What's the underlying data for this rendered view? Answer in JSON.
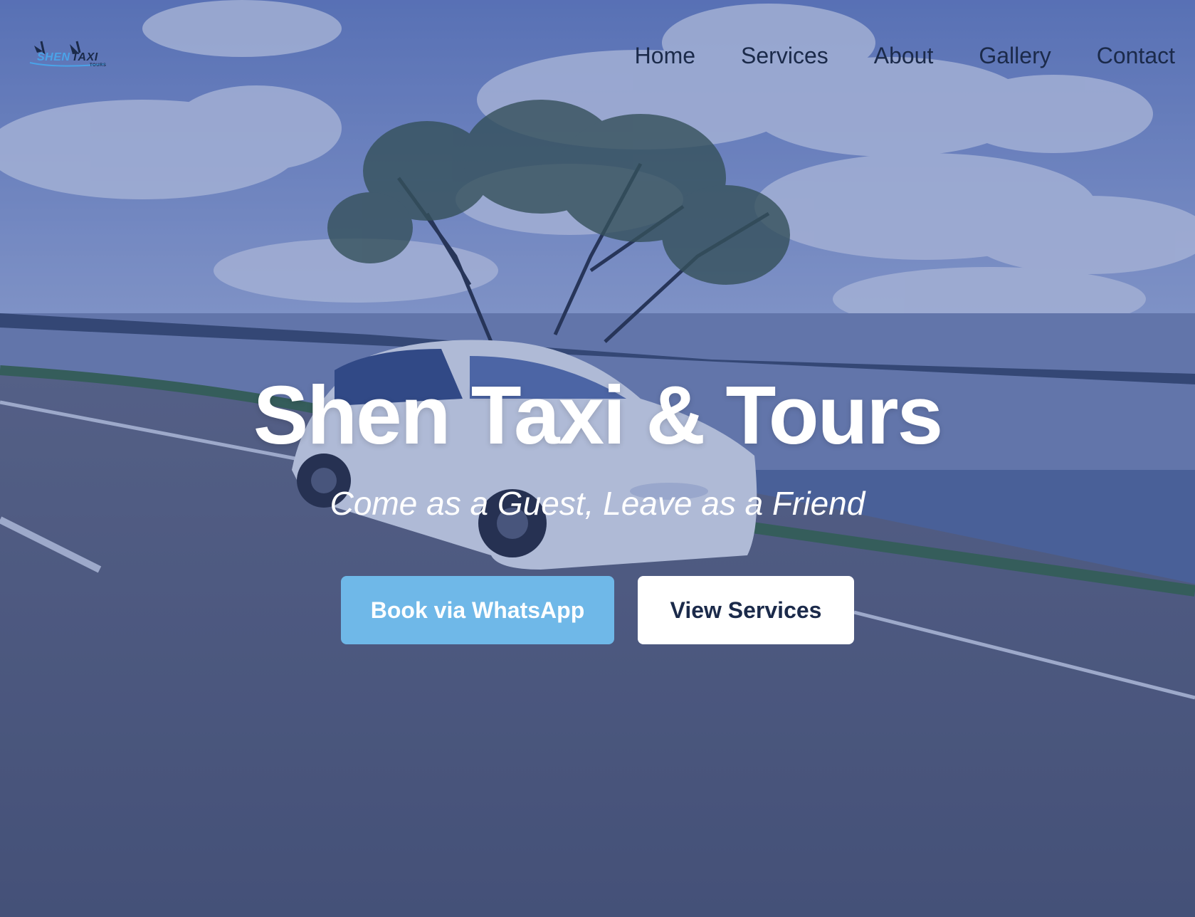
{
  "brand": {
    "logo_icon": "plane-logo-icon",
    "logo_word1": "SHEN",
    "logo_word2": "TAXI",
    "logo_sub": "TOURS"
  },
  "nav": {
    "items": [
      {
        "label": "Home"
      },
      {
        "label": "Services"
      },
      {
        "label": "About"
      },
      {
        "label": "Gallery"
      },
      {
        "label": "Contact"
      }
    ]
  },
  "hero": {
    "title": "Shen Taxi & Tours",
    "tagline": "Come as a Guest, Leave as a Friend",
    "primary_button": "Book via WhatsApp",
    "secondary_button": "View Services"
  },
  "colors": {
    "nav_text": "#1b2a4a",
    "primary_button_bg": "#6fb8e8",
    "secondary_button_bg": "#ffffff",
    "overlay": "#1e3a8a"
  }
}
